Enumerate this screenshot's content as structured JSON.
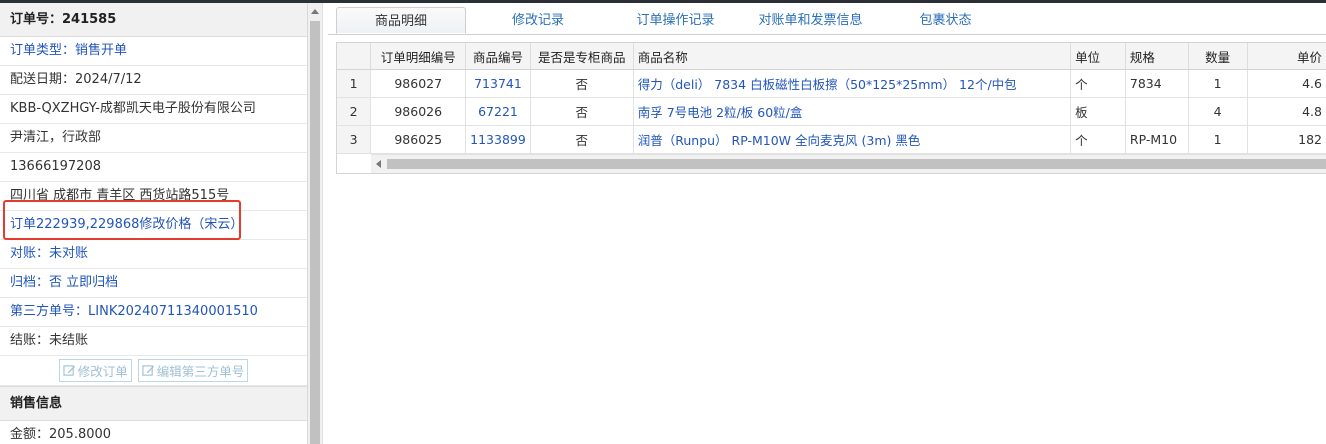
{
  "order": {
    "title": "订单号：241585",
    "type_label": "订单类型：",
    "type_value": "销售开单",
    "delivery_date": "配送日期：2024/7/12",
    "company": "KBB-QXZHGY-成都凯天电子股份有限公司",
    "contact": "尹清江，行政部",
    "phone": "13666197208",
    "address": "四川省 成都市 青羊区 西货站路515号",
    "note": "订单222939,229868修改价格（宋云）",
    "reconcile_label": "对账：",
    "reconcile_value": "未对账",
    "archive_label": "归档：",
    "archive_value": "否 立即归档",
    "third_label": "第三方单号：",
    "third_value": "LINK20240711340001510",
    "settle": "结账：未结账",
    "btn_edit": "修改订单",
    "btn_edit_third": "编辑第三方单号"
  },
  "sales": {
    "title": "销售信息",
    "amount": "金额：205.8000"
  },
  "tabs": [
    "商品明细",
    "修改记录",
    "订单操作记录",
    "对账单和发票信息",
    "包裹状态"
  ],
  "table": {
    "headers": [
      "订单明细编号",
      "商品编号",
      "是否是专柜商品",
      "商品名称",
      "单位",
      "规格",
      "数量",
      "单价"
    ],
    "rows": [
      {
        "n": "1",
        "detail": "986027",
        "code": "713741",
        "special": "否",
        "name": "得力（deli） 7834 白板磁性白板擦（50*125*25mm） 12个/中包",
        "unit": "个",
        "spec": "7834",
        "qty": "1",
        "price": "4.6"
      },
      {
        "n": "2",
        "detail": "986026",
        "code": "67221",
        "special": "否",
        "name": "南孚 7号电池 2粒/板 60粒/盒",
        "unit": "板",
        "spec": "",
        "qty": "4",
        "price": "4.8"
      },
      {
        "n": "3",
        "detail": "986025",
        "code": "1133899",
        "special": "否",
        "name": "润普（Runpu） RP-M10W 全向麦克风 (3m) 黑色",
        "unit": "个",
        "spec": "RP-M10",
        "qty": "1",
        "price": "182"
      }
    ]
  },
  "colors": {
    "link": "#2255bb",
    "highlight": "#e53b2f",
    "tab_link": "#2a6fb8"
  },
  "icons": [
    "edit-icon"
  ]
}
